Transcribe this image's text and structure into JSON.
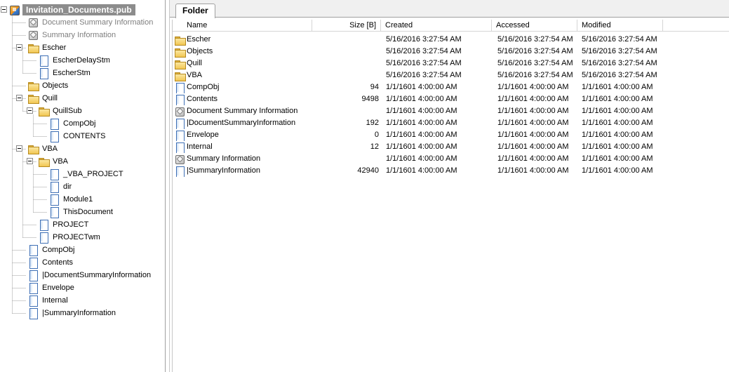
{
  "tree": {
    "root_label": "Invitation_Documents.pub",
    "items": [
      {
        "label": "Document Summary Information",
        "icon": "cube",
        "dim": true
      },
      {
        "label": "Summary Information",
        "icon": "cube",
        "dim": true
      },
      {
        "label": "Escher",
        "icon": "folder"
      },
      {
        "label": "EscherDelayStm",
        "icon": "doc"
      },
      {
        "label": "EscherStm",
        "icon": "doc"
      },
      {
        "label": "Objects",
        "icon": "folder"
      },
      {
        "label": "Quill",
        "icon": "folder"
      },
      {
        "label": "QuillSub",
        "icon": "folder"
      },
      {
        "label": "\u0001CompObj",
        "icon": "doc"
      },
      {
        "label": "CONTENTS",
        "icon": "doc"
      },
      {
        "label": "VBA",
        "icon": "folder"
      },
      {
        "label": "VBA",
        "icon": "folder"
      },
      {
        "label": "_VBA_PROJECT",
        "icon": "doc"
      },
      {
        "label": "dir",
        "icon": "doc"
      },
      {
        "label": "Module1",
        "icon": "doc"
      },
      {
        "label": "ThisDocument",
        "icon": "doc"
      },
      {
        "label": "PROJECT",
        "icon": "doc"
      },
      {
        "label": "PROJECTwm",
        "icon": "doc"
      },
      {
        "label": "\u0001CompObj",
        "icon": "doc"
      },
      {
        "label": "Contents",
        "icon": "doc"
      },
      {
        "label": "|DocumentSummaryInformation",
        "icon": "doc"
      },
      {
        "label": "Envelope",
        "icon": "doc"
      },
      {
        "label": "\u0004Internal",
        "icon": "doc"
      },
      {
        "label": "|SummaryInformation",
        "icon": "doc"
      }
    ]
  },
  "tabs": {
    "folder": "Folder"
  },
  "columns": {
    "name": "Name",
    "size": "Size [B]",
    "created": "Created",
    "accessed": "Accessed",
    "modified": "Modified"
  },
  "rows": [
    {
      "name": "Escher",
      "icon": "folder",
      "size": "",
      "created": "5/16/2016 3:27:54 AM",
      "accessed": "5/16/2016 3:27:54 AM",
      "modified": "5/16/2016 3:27:54 AM"
    },
    {
      "name": "Objects",
      "icon": "folder",
      "size": "",
      "created": "5/16/2016 3:27:54 AM",
      "accessed": "5/16/2016 3:27:54 AM",
      "modified": "5/16/2016 3:27:54 AM"
    },
    {
      "name": "Quill",
      "icon": "folder",
      "size": "",
      "created": "5/16/2016 3:27:54 AM",
      "accessed": "5/16/2016 3:27:54 AM",
      "modified": "5/16/2016 3:27:54 AM"
    },
    {
      "name": "VBA",
      "icon": "folder",
      "size": "",
      "created": "5/16/2016 3:27:54 AM",
      "accessed": "5/16/2016 3:27:54 AM",
      "modified": "5/16/2016 3:27:54 AM"
    },
    {
      "name": "\u0001CompObj",
      "icon": "doc",
      "size": "94",
      "created": "1/1/1601 4:00:00 AM",
      "accessed": "1/1/1601 4:00:00 AM",
      "modified": "1/1/1601 4:00:00 AM"
    },
    {
      "name": "Contents",
      "icon": "doc",
      "size": "9498",
      "created": "1/1/1601 4:00:00 AM",
      "accessed": "1/1/1601 4:00:00 AM",
      "modified": "1/1/1601 4:00:00 AM"
    },
    {
      "name": "Document Summary Information",
      "icon": "cube",
      "size": "",
      "created": "1/1/1601 4:00:00 AM",
      "accessed": "1/1/1601 4:00:00 AM",
      "modified": "1/1/1601 4:00:00 AM"
    },
    {
      "name": "|DocumentSummaryInformation",
      "icon": "doc",
      "size": "192",
      "created": "1/1/1601 4:00:00 AM",
      "accessed": "1/1/1601 4:00:00 AM",
      "modified": "1/1/1601 4:00:00 AM"
    },
    {
      "name": "Envelope",
      "icon": "doc",
      "size": "0",
      "created": "1/1/1601 4:00:00 AM",
      "accessed": "1/1/1601 4:00:00 AM",
      "modified": "1/1/1601 4:00:00 AM"
    },
    {
      "name": "\u0004Internal",
      "icon": "doc",
      "size": "12",
      "created": "1/1/1601 4:00:00 AM",
      "accessed": "1/1/1601 4:00:00 AM",
      "modified": "1/1/1601 4:00:00 AM"
    },
    {
      "name": "Summary Information",
      "icon": "cube",
      "size": "",
      "created": "1/1/1601 4:00:00 AM",
      "accessed": "1/1/1601 4:00:00 AM",
      "modified": "1/1/1601 4:00:00 AM"
    },
    {
      "name": "|SummaryInformation",
      "icon": "doc",
      "size": "42940",
      "created": "1/1/1601 4:00:00 AM",
      "accessed": "1/1/1601 4:00:00 AM",
      "modified": "1/1/1601 4:00:00 AM"
    }
  ],
  "colors": {
    "selection_bg": "#8c8c8c",
    "dim_text": "#7e7e7e",
    "folder": "#f2c652",
    "doc_border": "#3e6fb5"
  }
}
